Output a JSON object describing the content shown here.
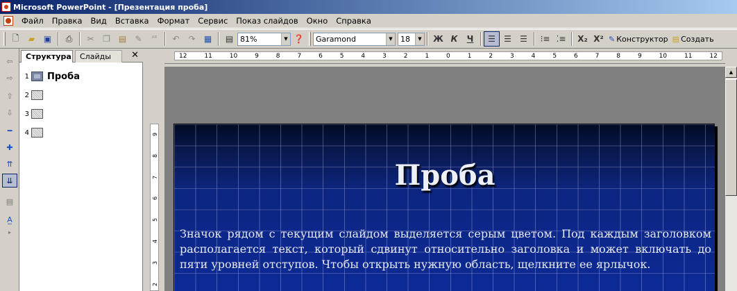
{
  "window": {
    "title": "Microsoft PowerPoint - [Презентация проба]"
  },
  "menu": [
    "Файл",
    "Правка",
    "Вид",
    "Вставка",
    "Формат",
    "Сервис",
    "Показ слайдов",
    "Окно",
    "Справка"
  ],
  "toolbar": {
    "zoom": "81%",
    "font": "Garamond",
    "size": "18",
    "bold": "Ж",
    "italic": "К",
    "underline": "Ч",
    "subscript": "X₂",
    "superscript": "X²",
    "designer_label": "Конструктор",
    "create_slide_label": "Создать"
  },
  "outline": {
    "tab_structure": "Структура",
    "tab_slides": "Слайды",
    "close": "✕",
    "slides": [
      {
        "num": "1",
        "title": "Проба"
      },
      {
        "num": "2",
        "title": ""
      },
      {
        "num": "3",
        "title": ""
      },
      {
        "num": "4",
        "title": ""
      }
    ]
  },
  "ruler": {
    "h": [
      "12",
      "11",
      "10",
      "9",
      "8",
      "7",
      "6",
      "5",
      "4",
      "3",
      "2",
      "1",
      "0",
      "1",
      "2",
      "3",
      "4",
      "5",
      "6",
      "7",
      "8",
      "9",
      "10",
      "11",
      "12"
    ],
    "v": [
      "9",
      "8",
      "7",
      "6",
      "5",
      "4",
      "3",
      "2"
    ]
  },
  "slide": {
    "title": "Проба",
    "body": "Значок рядом с текущим слайдом выделяется серым цветом. Под каждым заголовком располагается текст, который сдвинут относительно заголовка и может включать до пяти уровней отступов. Чтобы открыть нужную область, щелкните ее ярлычок."
  },
  "colors": {
    "titlebar": "#0a246a",
    "slide_bg": "#0c2a96"
  }
}
